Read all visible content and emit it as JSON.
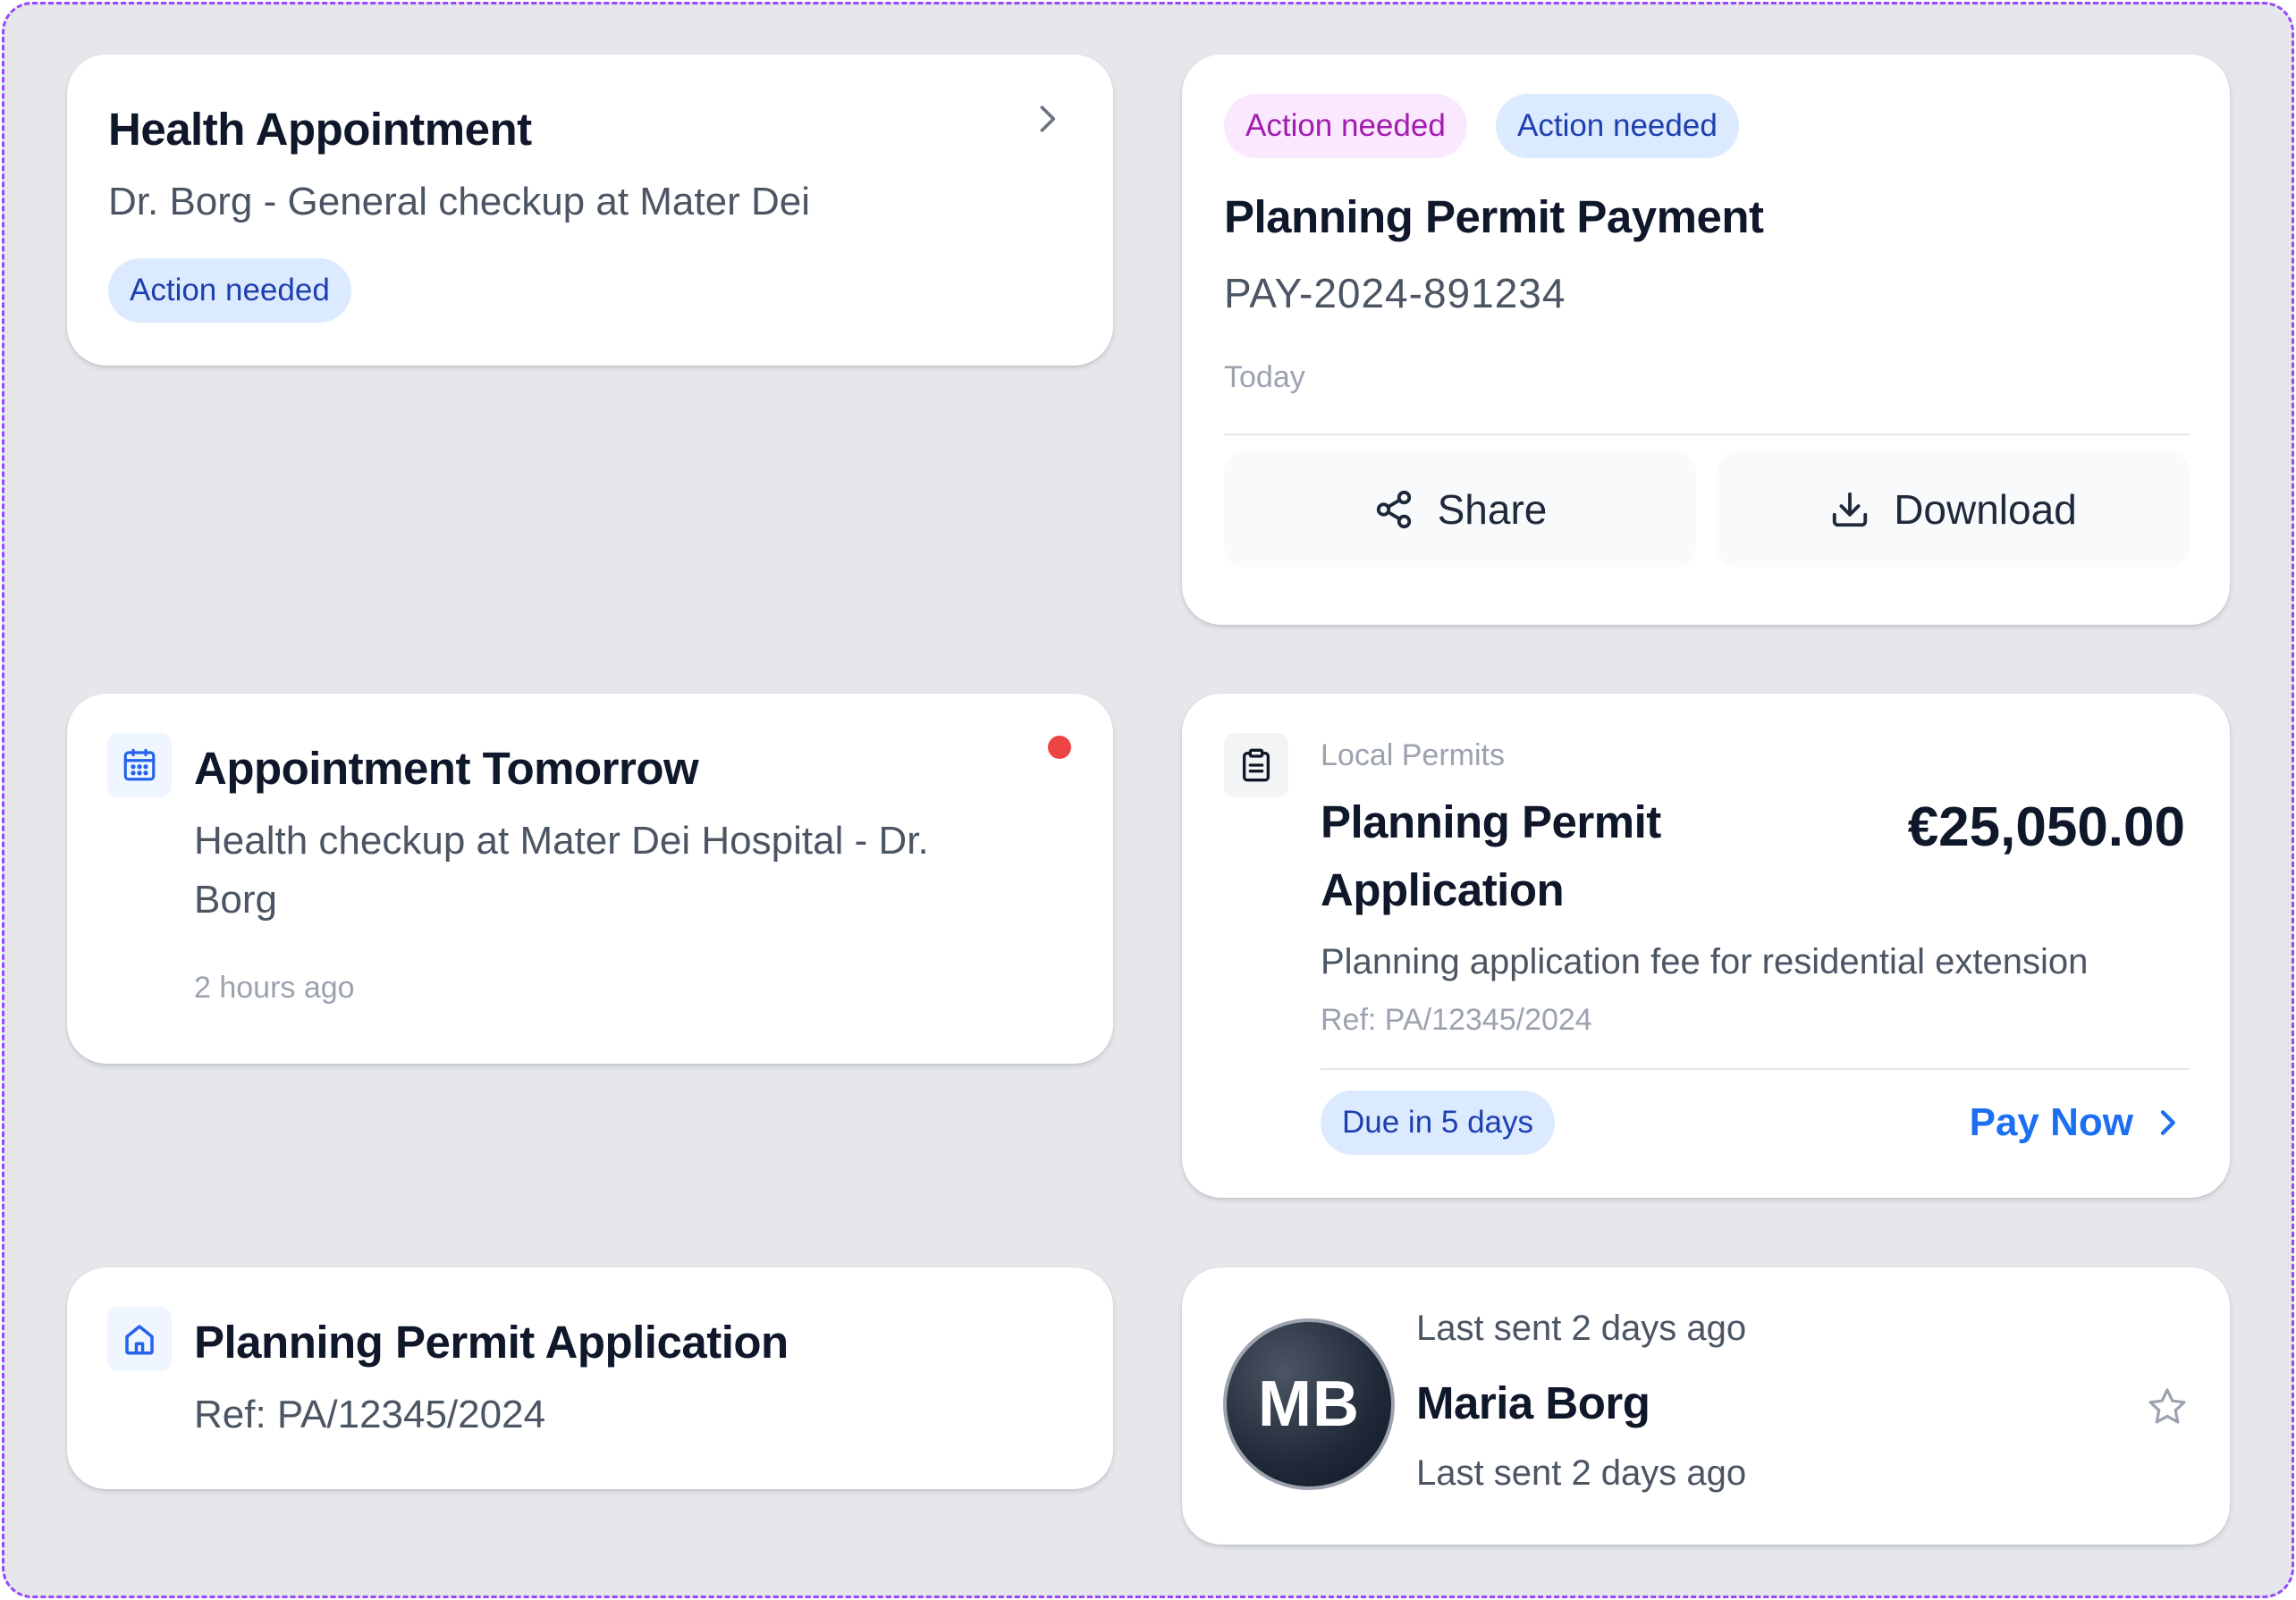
{
  "health_card": {
    "title": "Health Appointment",
    "subtitle": "Dr. Borg - General checkup at Mater Dei",
    "badge": "Action needed",
    "icon": "chevron-right-icon"
  },
  "payment_card": {
    "badges": [
      "Action needed",
      "Action needed"
    ],
    "title": "Planning Permit Payment",
    "reference": "PAY-2024-891234",
    "date": "Today",
    "share_label": "Share",
    "download_label": "Download",
    "icons": [
      "share-icon",
      "download-icon"
    ]
  },
  "appointment_card": {
    "title": "Appointment Tomorrow",
    "description_line1": "Health checkup at Mater Dei Hospital - Dr.",
    "description_line2": "Borg",
    "time": "2 hours ago",
    "icon": "calendar-icon",
    "unread_color": "#ef4444"
  },
  "permit_fee_card": {
    "category": "Local Permits",
    "title_line1": "Planning Permit",
    "title_line2": "Application",
    "amount": "€25,050.00",
    "description": "Planning application fee for residential extension",
    "reference": "Ref: PA/12345/2024",
    "due_badge": "Due in 5 days",
    "action_label": "Pay Now",
    "action_color": "#1d6ff2",
    "icon": "clipboard-icon"
  },
  "permit_app_card": {
    "title": "Planning Permit Application",
    "reference": "Ref: PA/12345/2024",
    "icon": "home-icon"
  },
  "contact_card": {
    "initials": "MB",
    "top_text": "Last sent 2 days ago",
    "name": "Maria Borg",
    "bottom_text": "Last sent 2 days ago",
    "icon": "star-icon"
  },
  "colors": {
    "background": "#e5e7eb",
    "badge_blue_bg": "#dbeafe",
    "badge_blue_text": "#1e40af",
    "badge_purple_bg": "#fae8ff",
    "badge_purple_text": "#a21caf"
  }
}
